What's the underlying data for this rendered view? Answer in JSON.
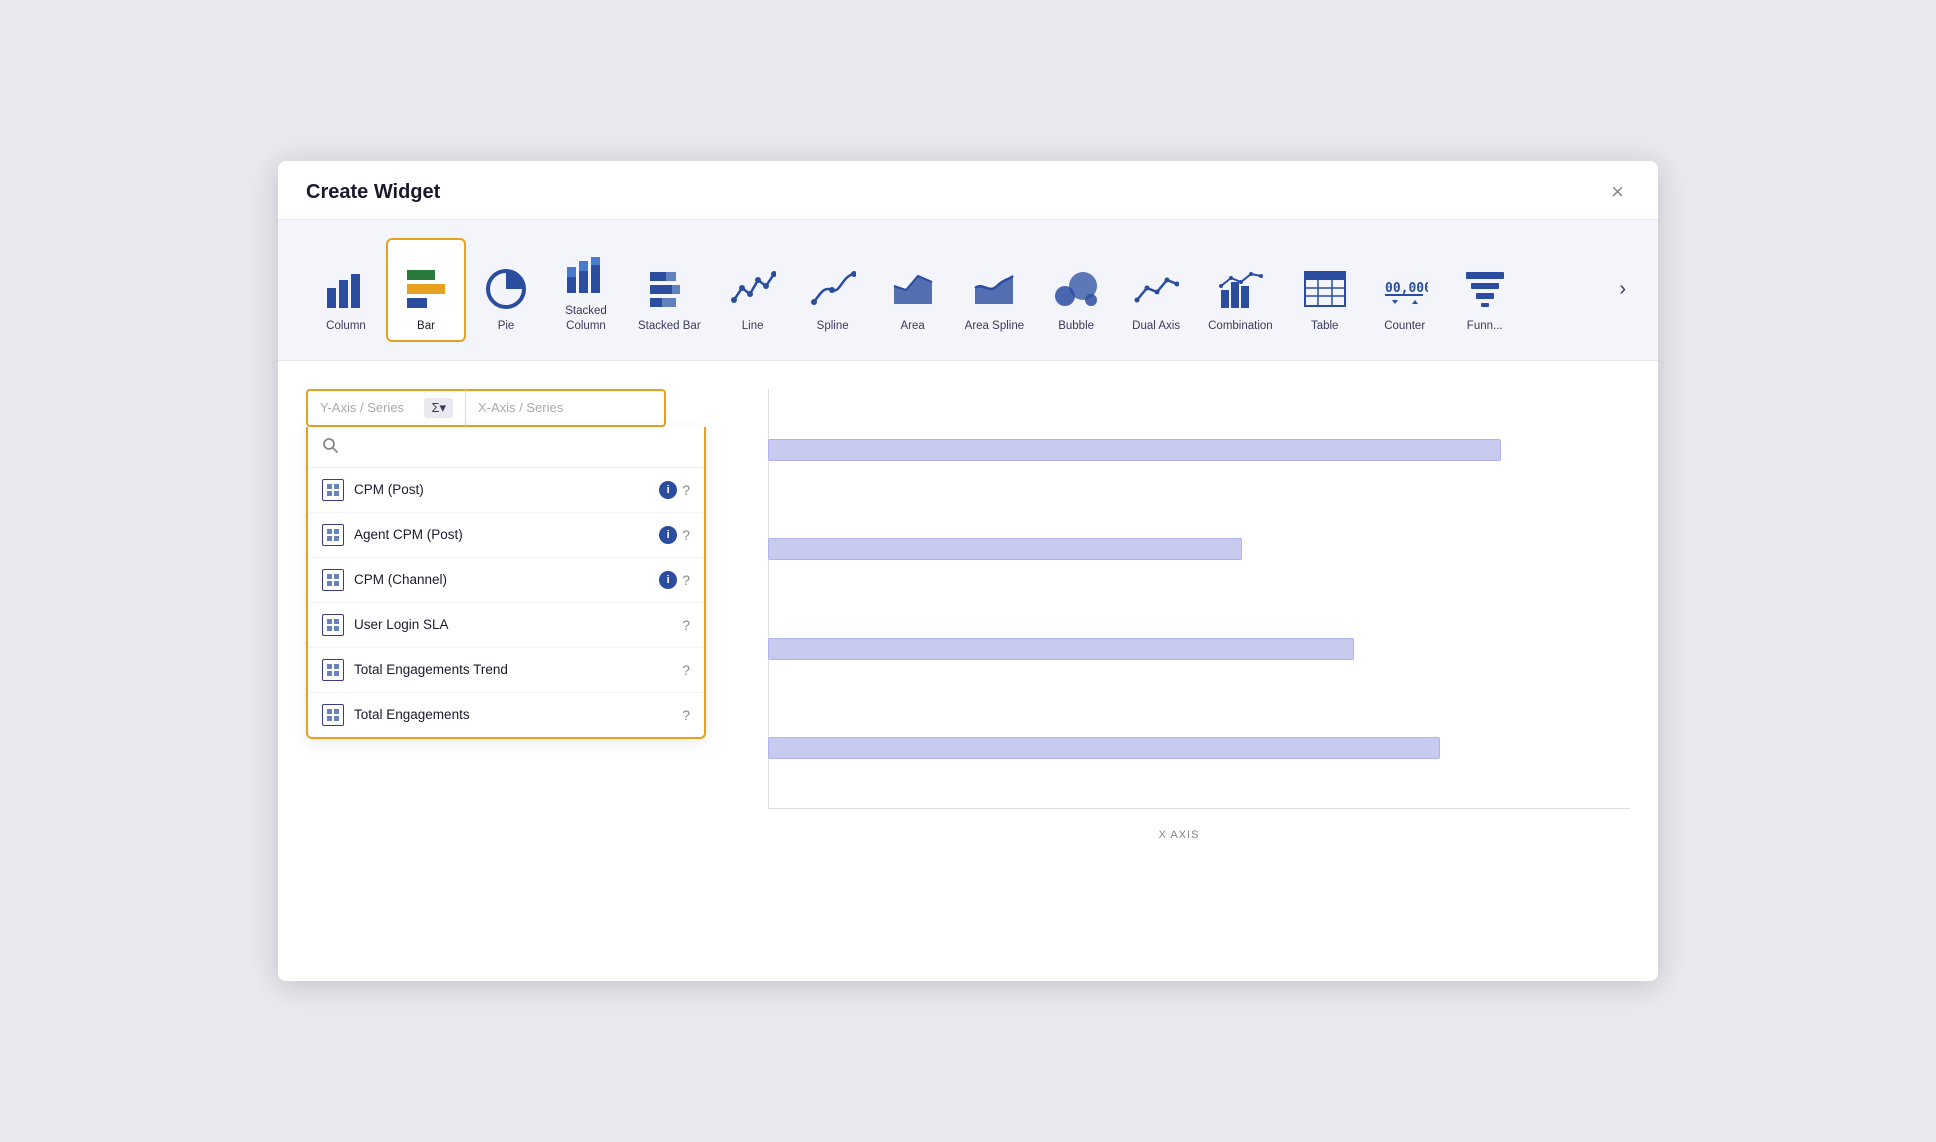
{
  "modal": {
    "title": "Create Widget",
    "close_label": "×"
  },
  "chart_types": [
    {
      "id": "column",
      "label": "Column",
      "selected": false
    },
    {
      "id": "bar",
      "label": "Bar",
      "selected": true
    },
    {
      "id": "pie",
      "label": "Pie",
      "selected": false
    },
    {
      "id": "stacked-column",
      "label": "Stacked\nColumn",
      "selected": false
    },
    {
      "id": "stacked-bar",
      "label": "Stacked Bar",
      "selected": false
    },
    {
      "id": "line",
      "label": "Line",
      "selected": false
    },
    {
      "id": "spline",
      "label": "Spline",
      "selected": false
    },
    {
      "id": "area",
      "label": "Area",
      "selected": false
    },
    {
      "id": "area-spline",
      "label": "Area Spline",
      "selected": false
    },
    {
      "id": "bubble",
      "label": "Bubble",
      "selected": false
    },
    {
      "id": "dual-axis",
      "label": "Dual Axis",
      "selected": false
    },
    {
      "id": "combination",
      "label": "Combination",
      "selected": false
    },
    {
      "id": "table",
      "label": "Table",
      "selected": false
    },
    {
      "id": "counter",
      "label": "Counter",
      "selected": false
    },
    {
      "id": "funnel",
      "label": "Funn...",
      "selected": false
    }
  ],
  "y_axis_placeholder": "Y-Axis / Series",
  "x_axis_placeholder": "X-Axis / Series",
  "sigma_label": "Σ▾",
  "search_placeholder": "",
  "dropdown_items": [
    {
      "id": "cpm-post",
      "label": "CPM (Post)",
      "has_info": true,
      "has_question": true
    },
    {
      "id": "agent-cpm-post",
      "label": "Agent CPM (Post)",
      "has_info": true,
      "has_question": true
    },
    {
      "id": "cpm-channel",
      "label": "CPM (Channel)",
      "has_info": true,
      "has_question": true
    },
    {
      "id": "user-login-sla",
      "label": "User Login SLA",
      "has_info": false,
      "has_question": true
    },
    {
      "id": "total-engagements-trend",
      "label": "Total Engagements Trend",
      "has_info": false,
      "has_question": true
    },
    {
      "id": "total-engagements",
      "label": "Total Engagements",
      "has_info": false,
      "has_question": true
    }
  ],
  "preview": {
    "x_axis_label": "X AXIS",
    "bars": [
      {
        "width_pct": 85
      },
      {
        "width_pct": 55
      },
      {
        "width_pct": 68
      },
      {
        "width_pct": 78
      }
    ]
  }
}
